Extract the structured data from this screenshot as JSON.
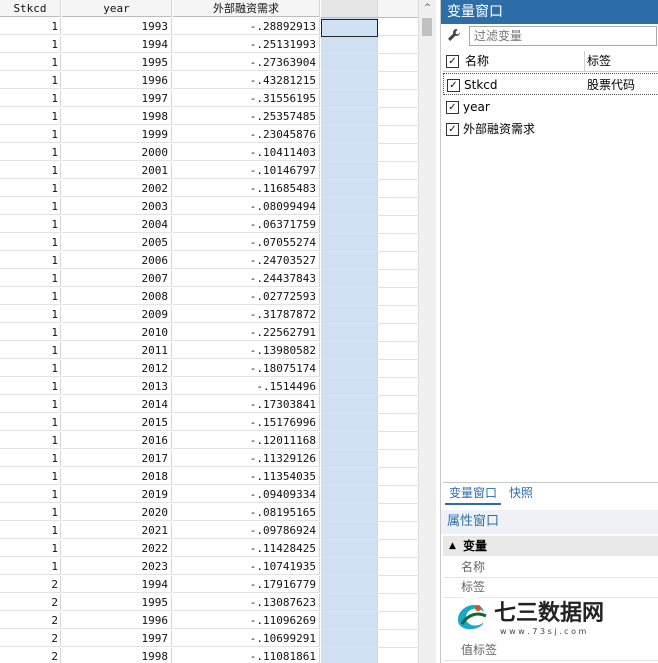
{
  "grid": {
    "headers": [
      "Stkcd",
      "year",
      "外部融资需求"
    ],
    "rows": [
      [
        "1",
        "1993",
        "-.28892913"
      ],
      [
        "1",
        "1994",
        "-.25131993"
      ],
      [
        "1",
        "1995",
        "-.27363904"
      ],
      [
        "1",
        "1996",
        "-.43281215"
      ],
      [
        "1",
        "1997",
        "-.31556195"
      ],
      [
        "1",
        "1998",
        "-.25357485"
      ],
      [
        "1",
        "1999",
        "-.23045876"
      ],
      [
        "1",
        "2000",
        "-.10411403"
      ],
      [
        "1",
        "2001",
        "-.10146797"
      ],
      [
        "1",
        "2002",
        "-.11685483"
      ],
      [
        "1",
        "2003",
        "-.08099494"
      ],
      [
        "1",
        "2004",
        "-.06371759"
      ],
      [
        "1",
        "2005",
        "-.07055274"
      ],
      [
        "1",
        "2006",
        "-.24703527"
      ],
      [
        "1",
        "2007",
        "-.24437843"
      ],
      [
        "1",
        "2008",
        "-.02772593"
      ],
      [
        "1",
        "2009",
        "-.31787872"
      ],
      [
        "1",
        "2010",
        "-.22562791"
      ],
      [
        "1",
        "2011",
        "-.13980582"
      ],
      [
        "1",
        "2012",
        "-.18075174"
      ],
      [
        "1",
        "2013",
        "-.1514496"
      ],
      [
        "1",
        "2014",
        "-.17303841"
      ],
      [
        "1",
        "2015",
        "-.15176996"
      ],
      [
        "1",
        "2016",
        "-.12011168"
      ],
      [
        "1",
        "2017",
        "-.11329126"
      ],
      [
        "1",
        "2018",
        "-.11354035"
      ],
      [
        "1",
        "2019",
        "-.09409334"
      ],
      [
        "1",
        "2020",
        "-.08195165"
      ],
      [
        "1",
        "2021",
        "-.09786924"
      ],
      [
        "1",
        "2022",
        "-.11428425"
      ],
      [
        "1",
        "2023",
        "-.10741935"
      ],
      [
        "2",
        "1994",
        "-.17916779"
      ],
      [
        "2",
        "1995",
        "-.13087623"
      ],
      [
        "2",
        "1996",
        "-.11096269"
      ],
      [
        "2",
        "1997",
        "-.10699291"
      ],
      [
        "2",
        "1998",
        "-.11081861"
      ]
    ]
  },
  "scrollbar": {
    "up_arrow": "^"
  },
  "variables_panel": {
    "title": "变量窗口",
    "filter_placeholder": "过滤变量",
    "col_name": "名称",
    "col_label": "标签",
    "variables": [
      {
        "name": "Stkcd",
        "label": "股票代码",
        "checked": "✓"
      },
      {
        "name": "year",
        "label": "",
        "checked": "✓"
      },
      {
        "name": "外部融资需求",
        "label": "",
        "checked": "✓"
      }
    ],
    "header_checked": "✓",
    "tabs": [
      "变量窗口",
      "快照"
    ]
  },
  "properties_panel": {
    "title": "属性窗口",
    "group": "变量",
    "fields": [
      "名称",
      "标签",
      "值标签"
    ]
  },
  "watermark": {
    "brand": "七三数据网",
    "url": "w w w . 7 3 s j . c o m"
  },
  "icons": {
    "filter": "wrench-icon",
    "expand": "triangle-down-icon"
  },
  "colors": {
    "panel_title": "#2e6ea8",
    "selected_column": "#cfe0f2"
  }
}
